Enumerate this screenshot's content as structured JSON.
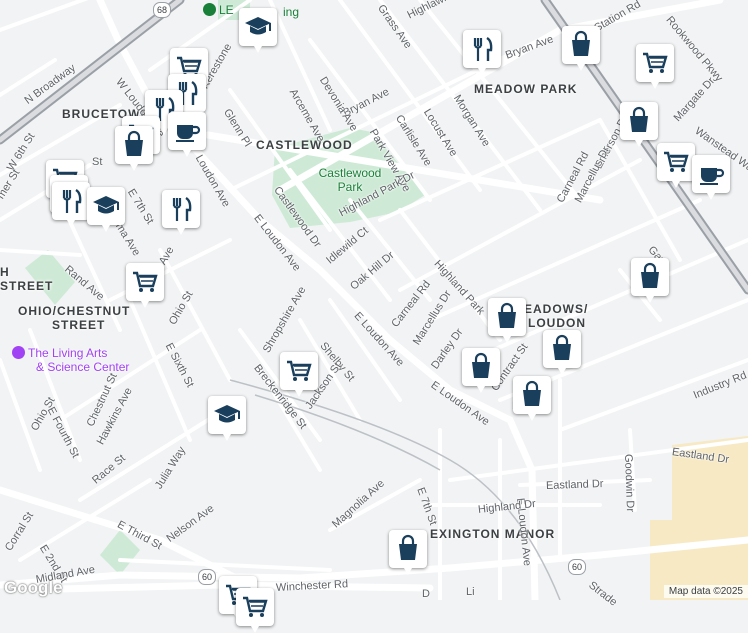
{
  "map": {
    "attribution": "Map data ©2025",
    "logo": "Google",
    "colors": {
      "background": "#f1f3f4",
      "road": "#ffffff",
      "highway": "#9aa0a6",
      "park": "#ceead6",
      "industrial": "#f7e9c3",
      "poi_pin": "#1a3f5c"
    }
  },
  "areas": {
    "meadow_park": "MEADOW PARK",
    "brucetown": "BRUCETOWN",
    "castlewood": "CASTLEWOOD",
    "ohio_chestnut_1": "OHIO/CHESTNUT",
    "ohio_chestnut_2": "STREET",
    "meadows_1": "EADOWS/",
    "meadows_2": "LOUDON",
    "lexington_manor": "EXINGTON MANOR",
    "street_left": "STREET",
    "h_left": "H"
  },
  "parks": {
    "castlewood_park_1": "Castlewood",
    "castlewood_park_2": "Park"
  },
  "places": {
    "living_arts_1": "The Living Arts",
    "living_arts_2": "& Science Center",
    "lexpark_partial": "LE",
    "lexpark_partial_2": "ing"
  },
  "shields": {
    "us68": "68",
    "us60_a": "60",
    "us60_b": "60"
  },
  "streets": {
    "n_broadway": "N Broadway",
    "w_loudon_ave": "W Loudon Ave",
    "bryan_ave_top": "Bryan Ave",
    "bryan_ave_mid": "Bryan Ave",
    "devonia_ave": "Devonia Ave",
    "arceme_ave": "Arceme Ave",
    "park_view_ave": "Park View Ave",
    "carlisle_ave": "Carlisle Ave",
    "locust_ave": "Locust Ave",
    "morgan_ave": "Morgan Ave",
    "emerson_dr": "Emerson Dr",
    "marcellus_dr_top": "Marcellus Dr",
    "carneal_rd_top": "Carneal Rd",
    "margate_dr": "Margate Dr",
    "rookwood_pkwy": "Rookwood Pkwy",
    "wanstead_way": "Wanstead Way",
    "station_rd": "ian Station Rd",
    "highlawn_ave": "Highlawn Ave",
    "grass_ave": "Grass Ave",
    "glenn_pl": "Glenn Pl",
    "kerestone": "Kerestone",
    "loudon_ave_left": "Loudon Ave",
    "e_loudon_ave_1": "E Loudon Ave",
    "e_loudon_ave_2": "E Loudon Ave",
    "e_loudon_ave_3": "E Loudon Ave",
    "e_loudon_ave_4": "E Loudon Ave",
    "castlewood_dr": "Castlewood Dr",
    "highland_park_dr": "Highland Park Dr",
    "highland_park_2": "Highland Park",
    "idlewild_ct": "Idlewild Ct",
    "oak_hill_dr": "Oak Hill Dr",
    "carneal_rd": "Carneal Rd",
    "marcellus_dr": "Marcellus Dr",
    "darley_dr": "Darley Dr",
    "contract_st": "Contract St",
    "industry_rd": "Industry Rd",
    "eastland_dr_1": "Eastland Dr",
    "eastland_dr_2": "Eastland Dr",
    "goodwin_dr": "Goodwin Dr",
    "highland_dr": "Highland Dr",
    "e_7th_st_bottom": "E 7th St",
    "magnolia_ave": "Magnolia Ave",
    "shropshire_ave": "Shropshire Ave",
    "shelby_st": "Shelby St",
    "jackson_st": "Jackson St",
    "breckenridge_st": "Breckenridge St",
    "ohio_st_mid": "Ohio St",
    "e_sixth_st": "E Sixth St",
    "ohio_st_low": "Ohio St",
    "e_fourth_st": "E Fourth St",
    "chestnut_st": "Chestnut St",
    "hawkins_ave": "Hawkins Ave",
    "race_st": "Race St",
    "julia_way": "Julia Way",
    "e_third_st": "E Third St",
    "nelson_ave": "Nelson Ave",
    "corral_st": "Corral St",
    "e_2nd_st": "E 2nd St",
    "midland_ave": "Midland Ave",
    "winchester_rd": "Winchester Rd",
    "e_7th_st_left": "E 7th St",
    "rand_ave": "Rand Ave",
    "w_6th_st": "W 6th St",
    "mer_st": "mer St",
    "ma_ave": "ma Ave",
    "ave_frag": "Ave",
    "st_frag": "St",
    "gay_frag": "Gay",
    "stra_frag": "Strade",
    "n_frag": "N",
    "e_frag": "E",
    "li_frag": "Li",
    "d_frag": "D"
  },
  "pois": [
    {
      "name": "shopping-cart",
      "kind": "grocery-icon"
    },
    {
      "name": "shopping-cart",
      "kind": "grocery-icon"
    },
    {
      "name": "shopping-cart",
      "kind": "grocery-icon"
    },
    {
      "name": "shopping-cart",
      "kind": "grocery-icon"
    },
    {
      "name": "shopping-cart",
      "kind": "grocery-icon"
    },
    {
      "name": "shopping-bag",
      "kind": "shopping-icon"
    },
    {
      "name": "restaurant",
      "kind": "restaurant-icon"
    },
    {
      "name": "cafe",
      "kind": "cafe-icon"
    },
    {
      "name": "school",
      "kind": "school-icon"
    }
  ]
}
